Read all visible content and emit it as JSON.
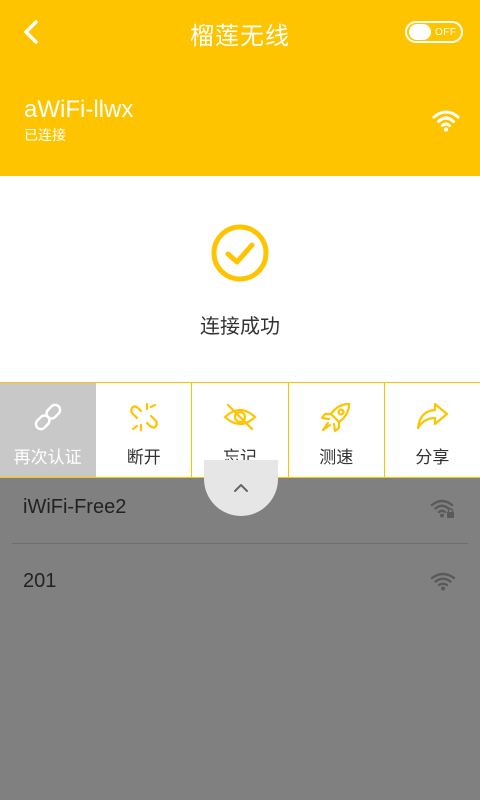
{
  "header": {
    "title": "榴莲无线",
    "toggle_label": "OFF"
  },
  "connection": {
    "ssid": "aWiFi-llwx",
    "status": "已连接",
    "message": "连接成功"
  },
  "actions": [
    {
      "label": "再次认证",
      "icon": "link-icon",
      "active": true
    },
    {
      "label": "断开",
      "icon": "broken-link-icon"
    },
    {
      "label": "忘记",
      "icon": "eye-off-icon"
    },
    {
      "label": "测速",
      "icon": "rocket-icon"
    },
    {
      "label": "分享",
      "icon": "share-arrow-icon"
    }
  ],
  "networks": [
    {
      "name": "iWiFi-Free2",
      "icon": "wifi-locked-icon"
    },
    {
      "name": "201",
      "icon": "wifi-icon"
    }
  ],
  "colors": {
    "accent": "#FFC400",
    "overlay": "#808080",
    "active_action": "#C8C8C8"
  }
}
